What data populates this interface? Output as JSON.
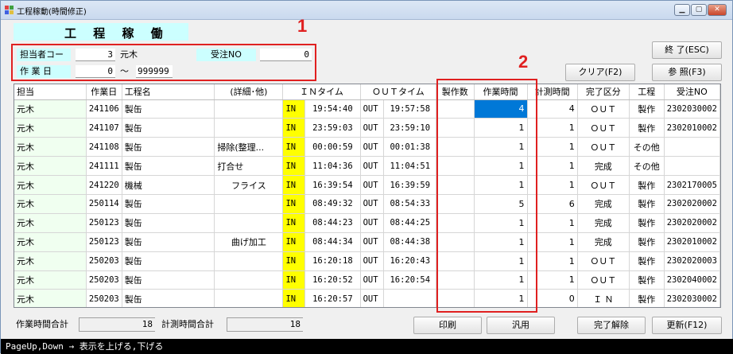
{
  "window": {
    "title": "工程稼動(時間修正)"
  },
  "heading": "工 程 稼 働",
  "filters": {
    "staff_label": "担当者コー",
    "staff_code": "3",
    "staff_name": "元木",
    "order_label": "受注NO",
    "order_value": "0",
    "date_label": "作 業 日",
    "date_from": "0",
    "date_sep": "～",
    "date_to": "999999"
  },
  "annotations": {
    "box1": "1",
    "box2": "2"
  },
  "buttons": {
    "exit": "終 了(ESC)",
    "clear": "クリア(F2)",
    "ref": "参 照(F3)",
    "print": "印刷",
    "general": "汎用",
    "unfinish": "完了解除",
    "update": "更新(F12)"
  },
  "table": {
    "headers": [
      "担当",
      "作業日",
      "工程名",
      "(詳細･他)",
      "ＩＮタイム",
      "ＯＵＴタイム",
      "製作数",
      "作業時間",
      "計測時間",
      "完了区分",
      "工程",
      "受注NO"
    ],
    "rows": [
      [
        "元木",
        "241106",
        "製缶",
        "",
        "IN",
        "19:54:40",
        "OUT",
        "19:57:58",
        "",
        "4",
        "4",
        "ＯＵＴ",
        "製作",
        "2302030002"
      ],
      [
        "元木",
        "241107",
        "製缶",
        "",
        "IN",
        "23:59:03",
        "OUT",
        "23:59:10",
        "",
        "1",
        "1",
        "ＯＵＴ",
        "製作",
        "2302010002"
      ],
      [
        "元木",
        "241108",
        "製缶",
        "掃除(整理...",
        "IN",
        "00:00:59",
        "OUT",
        "00:01:38",
        "",
        "1",
        "1",
        "ＯＵＴ",
        "その他",
        ""
      ],
      [
        "元木",
        "241111",
        "製缶",
        "打合せ",
        "IN",
        "11:04:36",
        "OUT",
        "11:04:51",
        "",
        "1",
        "1",
        "完成",
        "その他",
        ""
      ],
      [
        "元木",
        "241220",
        "機械",
        "フライス",
        "IN",
        "16:39:54",
        "OUT",
        "16:39:59",
        "",
        "1",
        "1",
        "ＯＵＴ",
        "製作",
        "2302170005"
      ],
      [
        "元木",
        "250114",
        "製缶",
        "",
        "IN",
        "08:49:32",
        "OUT",
        "08:54:33",
        "",
        "5",
        "6",
        "完成",
        "製作",
        "2302020002"
      ],
      [
        "元木",
        "250123",
        "製缶",
        "",
        "IN",
        "08:44:23",
        "OUT",
        "08:44:25",
        "",
        "1",
        "1",
        "完成",
        "製作",
        "2302020002"
      ],
      [
        "元木",
        "250123",
        "製缶",
        "曲げ加工",
        "IN",
        "08:44:34",
        "OUT",
        "08:44:38",
        "",
        "1",
        "1",
        "完成",
        "製作",
        "2302010002"
      ],
      [
        "元木",
        "250203",
        "製缶",
        "",
        "IN",
        "16:20:18",
        "OUT",
        "16:20:43",
        "",
        "1",
        "1",
        "ＯＵＴ",
        "製作",
        "2302020003"
      ],
      [
        "元木",
        "250203",
        "製缶",
        "",
        "IN",
        "16:20:52",
        "OUT",
        "16:20:54",
        "",
        "1",
        "1",
        "ＯＵＴ",
        "製作",
        "2302040002"
      ],
      [
        "元木",
        "250203",
        "製缶",
        "",
        "IN",
        "16:20:57",
        "OUT",
        "",
        "",
        "1",
        "0",
        "Ｉ Ｎ",
        "製作",
        "2302030002"
      ]
    ]
  },
  "totals": {
    "work_label": "作業時間合計",
    "work_value": "18",
    "measure_label": "計測時間合計",
    "measure_value": "18"
  },
  "status": "PageUp,Down → 表示を上げる,下げる",
  "colors": {
    "accent_red": "#e02020",
    "header_cyan": "#ccffff",
    "in_yellow": "#ffff00",
    "selection": "#0078d7"
  }
}
